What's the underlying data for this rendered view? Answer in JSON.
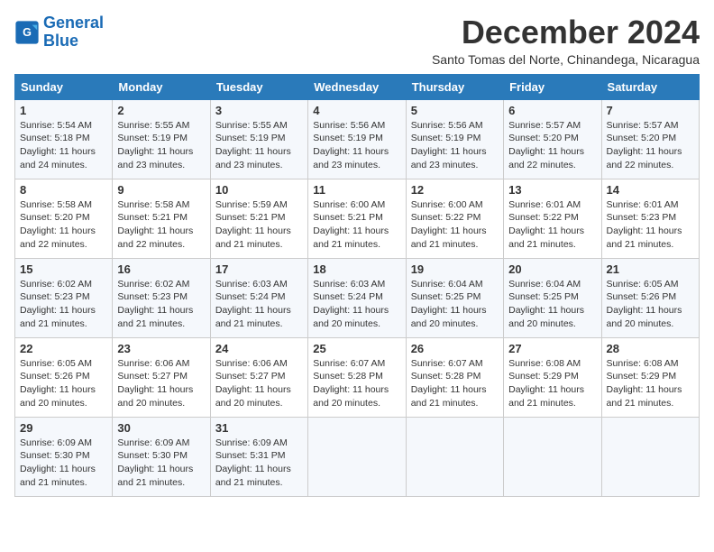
{
  "logo": {
    "line1": "General",
    "line2": "Blue"
  },
  "title": "December 2024",
  "subtitle": "Santo Tomas del Norte, Chinandega, Nicaragua",
  "days_of_week": [
    "Sunday",
    "Monday",
    "Tuesday",
    "Wednesday",
    "Thursday",
    "Friday",
    "Saturday"
  ],
  "weeks": [
    [
      {
        "day": 1,
        "info": "Sunrise: 5:54 AM\nSunset: 5:18 PM\nDaylight: 11 hours\nand 24 minutes."
      },
      {
        "day": 2,
        "info": "Sunrise: 5:55 AM\nSunset: 5:19 PM\nDaylight: 11 hours\nand 23 minutes."
      },
      {
        "day": 3,
        "info": "Sunrise: 5:55 AM\nSunset: 5:19 PM\nDaylight: 11 hours\nand 23 minutes."
      },
      {
        "day": 4,
        "info": "Sunrise: 5:56 AM\nSunset: 5:19 PM\nDaylight: 11 hours\nand 23 minutes."
      },
      {
        "day": 5,
        "info": "Sunrise: 5:56 AM\nSunset: 5:19 PM\nDaylight: 11 hours\nand 23 minutes."
      },
      {
        "day": 6,
        "info": "Sunrise: 5:57 AM\nSunset: 5:20 PM\nDaylight: 11 hours\nand 22 minutes."
      },
      {
        "day": 7,
        "info": "Sunrise: 5:57 AM\nSunset: 5:20 PM\nDaylight: 11 hours\nand 22 minutes."
      }
    ],
    [
      {
        "day": 8,
        "info": "Sunrise: 5:58 AM\nSunset: 5:20 PM\nDaylight: 11 hours\nand 22 minutes."
      },
      {
        "day": 9,
        "info": "Sunrise: 5:58 AM\nSunset: 5:21 PM\nDaylight: 11 hours\nand 22 minutes."
      },
      {
        "day": 10,
        "info": "Sunrise: 5:59 AM\nSunset: 5:21 PM\nDaylight: 11 hours\nand 21 minutes."
      },
      {
        "day": 11,
        "info": "Sunrise: 6:00 AM\nSunset: 5:21 PM\nDaylight: 11 hours\nand 21 minutes."
      },
      {
        "day": 12,
        "info": "Sunrise: 6:00 AM\nSunset: 5:22 PM\nDaylight: 11 hours\nand 21 minutes."
      },
      {
        "day": 13,
        "info": "Sunrise: 6:01 AM\nSunset: 5:22 PM\nDaylight: 11 hours\nand 21 minutes."
      },
      {
        "day": 14,
        "info": "Sunrise: 6:01 AM\nSunset: 5:23 PM\nDaylight: 11 hours\nand 21 minutes."
      }
    ],
    [
      {
        "day": 15,
        "info": "Sunrise: 6:02 AM\nSunset: 5:23 PM\nDaylight: 11 hours\nand 21 minutes."
      },
      {
        "day": 16,
        "info": "Sunrise: 6:02 AM\nSunset: 5:23 PM\nDaylight: 11 hours\nand 21 minutes."
      },
      {
        "day": 17,
        "info": "Sunrise: 6:03 AM\nSunset: 5:24 PM\nDaylight: 11 hours\nand 21 minutes."
      },
      {
        "day": 18,
        "info": "Sunrise: 6:03 AM\nSunset: 5:24 PM\nDaylight: 11 hours\nand 20 minutes."
      },
      {
        "day": 19,
        "info": "Sunrise: 6:04 AM\nSunset: 5:25 PM\nDaylight: 11 hours\nand 20 minutes."
      },
      {
        "day": 20,
        "info": "Sunrise: 6:04 AM\nSunset: 5:25 PM\nDaylight: 11 hours\nand 20 minutes."
      },
      {
        "day": 21,
        "info": "Sunrise: 6:05 AM\nSunset: 5:26 PM\nDaylight: 11 hours\nand 20 minutes."
      }
    ],
    [
      {
        "day": 22,
        "info": "Sunrise: 6:05 AM\nSunset: 5:26 PM\nDaylight: 11 hours\nand 20 minutes."
      },
      {
        "day": 23,
        "info": "Sunrise: 6:06 AM\nSunset: 5:27 PM\nDaylight: 11 hours\nand 20 minutes."
      },
      {
        "day": 24,
        "info": "Sunrise: 6:06 AM\nSunset: 5:27 PM\nDaylight: 11 hours\nand 20 minutes."
      },
      {
        "day": 25,
        "info": "Sunrise: 6:07 AM\nSunset: 5:28 PM\nDaylight: 11 hours\nand 20 minutes."
      },
      {
        "day": 26,
        "info": "Sunrise: 6:07 AM\nSunset: 5:28 PM\nDaylight: 11 hours\nand 21 minutes."
      },
      {
        "day": 27,
        "info": "Sunrise: 6:08 AM\nSunset: 5:29 PM\nDaylight: 11 hours\nand 21 minutes."
      },
      {
        "day": 28,
        "info": "Sunrise: 6:08 AM\nSunset: 5:29 PM\nDaylight: 11 hours\nand 21 minutes."
      }
    ],
    [
      {
        "day": 29,
        "info": "Sunrise: 6:09 AM\nSunset: 5:30 PM\nDaylight: 11 hours\nand 21 minutes."
      },
      {
        "day": 30,
        "info": "Sunrise: 6:09 AM\nSunset: 5:30 PM\nDaylight: 11 hours\nand 21 minutes."
      },
      {
        "day": 31,
        "info": "Sunrise: 6:09 AM\nSunset: 5:31 PM\nDaylight: 11 hours\nand 21 minutes."
      },
      null,
      null,
      null,
      null
    ]
  ]
}
